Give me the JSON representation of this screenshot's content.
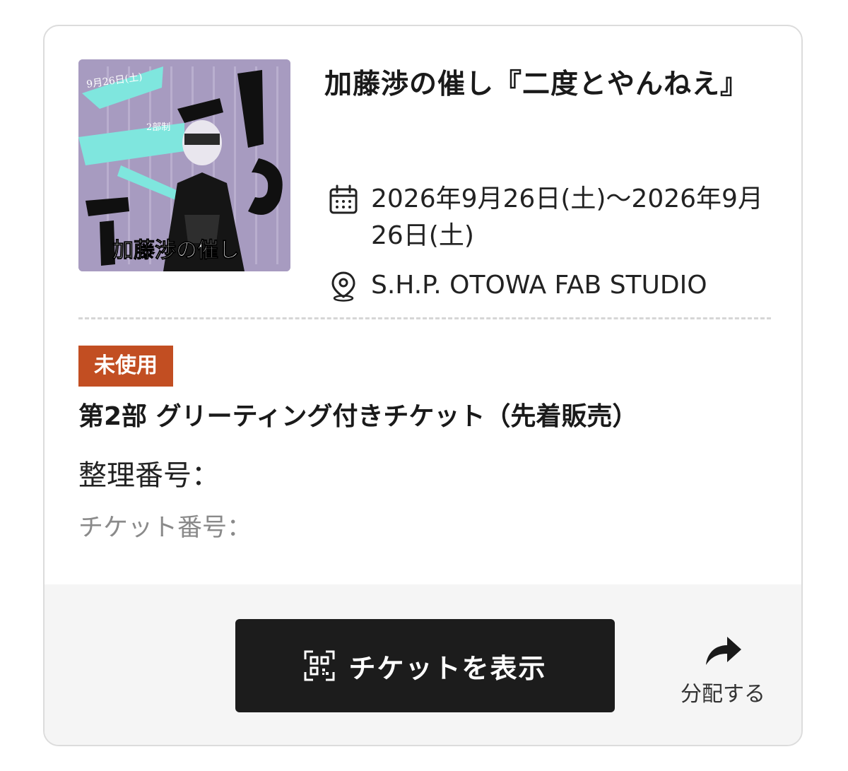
{
  "event": {
    "title": "加藤渉の催し『二度とやんねえ』",
    "date": "2026年9月26日(土)〜2026年9月26日(土)",
    "venue": "S.H.P. OTOWA FAB STUDIO",
    "thumbnail": {
      "date_text": "9月26日(土)",
      "parts_text": "2部制",
      "title_text": "加藤渉の催し",
      "big_text": "二度とやんねえ"
    }
  },
  "ticket": {
    "status_badge": "未使用",
    "type": "第2部 グリーティング付きチケット（先着販売）",
    "seat_label": "整理番号：",
    "seat_value": "",
    "number_label": "チケット番号：",
    "number_value": ""
  },
  "actions": {
    "show_ticket_label": "チケットを表示",
    "share_label": "分配する"
  },
  "colors": {
    "badge": "#c24e22",
    "button": "#1c1c1c",
    "thumbnail_bg": "#a79bc0",
    "thumbnail_accent": "#7fe6de"
  },
  "icons": {
    "calendar": "calendar-icon",
    "location": "location-pin-icon",
    "qr": "qr-code-icon",
    "share": "share-arrow-icon"
  }
}
